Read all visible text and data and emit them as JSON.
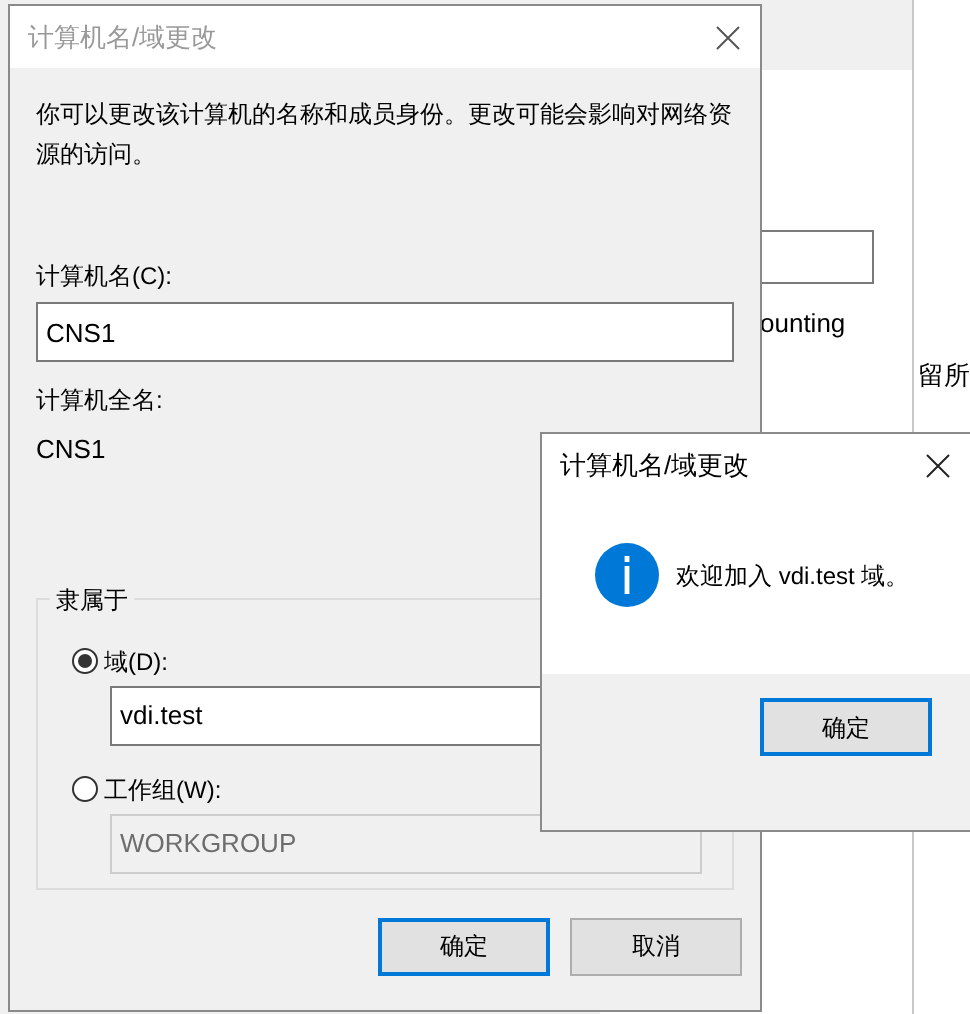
{
  "background_window": {
    "texts": [
      "ounting",
      "留所"
    ]
  },
  "dialog": {
    "title": "计算机名/域更改",
    "active": false,
    "description": "你可以更改该计算机的名称和成员身份。更改可能会影响对网络资源的访问。",
    "computer_name_label": "计算机名(C):",
    "computer_name": "CNS1",
    "full_name_label": "计算机全名:",
    "full_name": "CNS1",
    "member_of": {
      "legend": "隶属于",
      "options": [
        {
          "label": "域(D):",
          "selected": true,
          "value": "vdi.test"
        },
        {
          "label": "工作组(W):",
          "selected": false,
          "value": "WORKGROUP"
        }
      ]
    },
    "buttons": [
      {
        "label": "确定",
        "default": true
      },
      {
        "label": "取消",
        "default": false
      }
    ]
  },
  "message_box": {
    "title": "计算机名/域更改",
    "active": true,
    "message": "欢迎加入 vdi.test 域。",
    "buttons": [
      {
        "label": "确定",
        "default": true
      }
    ]
  }
}
